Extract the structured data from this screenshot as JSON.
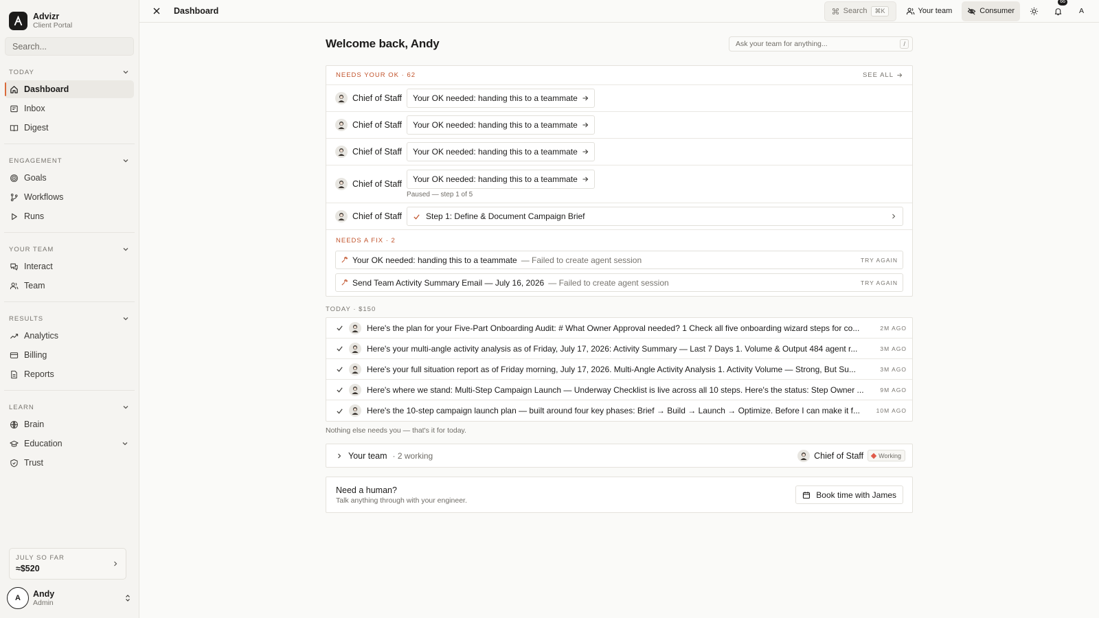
{
  "brand": {
    "name": "Advizr",
    "subtitle": "Client Portal"
  },
  "sidebar": {
    "search_placeholder": "Search...",
    "sections": [
      {
        "label": "TODAY",
        "items": [
          {
            "label": "Dashboard",
            "icon": "home-icon",
            "active": true
          },
          {
            "label": "Inbox",
            "icon": "inbox-icon"
          },
          {
            "label": "Digest",
            "icon": "book-icon"
          }
        ]
      },
      {
        "label": "ENGAGEMENT",
        "items": [
          {
            "label": "Goals",
            "icon": "target-icon"
          },
          {
            "label": "Workflows",
            "icon": "branch-icon"
          },
          {
            "label": "Runs",
            "icon": "play-icon"
          }
        ]
      },
      {
        "label": "YOUR TEAM",
        "items": [
          {
            "label": "Interact",
            "icon": "chat-icon"
          },
          {
            "label": "Team",
            "icon": "users-icon"
          }
        ]
      },
      {
        "label": "RESULTS",
        "items": [
          {
            "label": "Analytics",
            "icon": "trend-icon"
          },
          {
            "label": "Billing",
            "icon": "card-icon"
          },
          {
            "label": "Reports",
            "icon": "file-icon"
          }
        ]
      },
      {
        "label": "LEARN",
        "items": [
          {
            "label": "Brain",
            "icon": "brain-icon"
          },
          {
            "label": "Education",
            "icon": "cap-icon",
            "has_chevron": true
          },
          {
            "label": "Trust",
            "icon": "shield-icon"
          }
        ]
      }
    ],
    "spend": {
      "label": "JULY SO FAR",
      "value": "≈$520"
    },
    "user": {
      "initial": "A",
      "name": "Andy",
      "role": "Admin"
    }
  },
  "topbar": {
    "title": "Dashboard",
    "search_label": "Search",
    "search_kbd": "⌘K",
    "team_label": "Your team",
    "mode_label": "Consumer",
    "notif_count": "66",
    "avatar_initial": "A"
  },
  "main": {
    "welcome": "Welcome back, Andy",
    "ask_placeholder": "Ask your team for anything...",
    "ask_kbd": "/",
    "needs_ok": {
      "header": "NEEDS YOUR OK · 62",
      "see_all": "SEE ALL",
      "rows": [
        {
          "agent": "Chief of Staff",
          "chip": "Your OK needed: handing this to a teammate"
        },
        {
          "agent": "Chief of Staff",
          "chip": "Your OK needed: handing this to a teammate"
        },
        {
          "agent": "Chief of Staff",
          "chip": "Your OK needed: handing this to a teammate"
        },
        {
          "agent": "Chief of Staff",
          "chip": "Your OK needed: handing this to a teammate",
          "note": "Paused — step 1 of 5"
        }
      ],
      "step_row": {
        "agent": "Chief of Staff",
        "step": "Step 1: Define & Document Campaign Brief"
      }
    },
    "needs_fix": {
      "header": "NEEDS A FIX · 2",
      "rows": [
        {
          "title": "Your OK needed: handing this to a teammate",
          "error": "— Failed to create agent session",
          "action": "TRY AGAIN"
        },
        {
          "title": "Send Team Activity Summary Email — July 16, 2026",
          "error": "— Failed to create agent session",
          "action": "TRY AGAIN"
        }
      ]
    },
    "today": {
      "header": "TODAY · $150",
      "rows": [
        {
          "text": "Here's the plan for your Five-Part Onboarding Audit: # What Owner Approval needed? 1 Check all five onboarding wizard steps for co...",
          "ago": "2M AGO"
        },
        {
          "text": "Here's your multi-angle activity analysis as of Friday, July 17, 2026: Activity Summary — Last 7 Days 1. Volume & Output 484 agent r...",
          "ago": "3M AGO"
        },
        {
          "text": "Here's your full situation report as of Friday morning, July 17, 2026. Multi-Angle Activity Analysis 1. Activity Volume — Strong, But Su...",
          "ago": "3M AGO"
        },
        {
          "text": "Here's where we stand: Multi-Step Campaign Launch — Underway Checklist is live across all 10 steps. Here's the status: Step Owner ...",
          "ago": "9M AGO"
        },
        {
          "text": "Here's the 10-step campaign launch plan — built around four key phases: Brief → Build → Launch → Optimize. Before I can make it f...",
          "ago": "10M AGO"
        }
      ],
      "footer": "Nothing else needs you — that's it for today."
    },
    "team": {
      "label": "Your team",
      "working": "· 2 working",
      "agent": "Chief of Staff",
      "status": "Working"
    },
    "human": {
      "title": "Need a human?",
      "subtitle": "Talk anything through with your engineer.",
      "button": "Book time with James"
    }
  },
  "colors": {
    "accent": "#c1532b",
    "active_bar": "#d96a3a",
    "working": "#e05a4a"
  }
}
